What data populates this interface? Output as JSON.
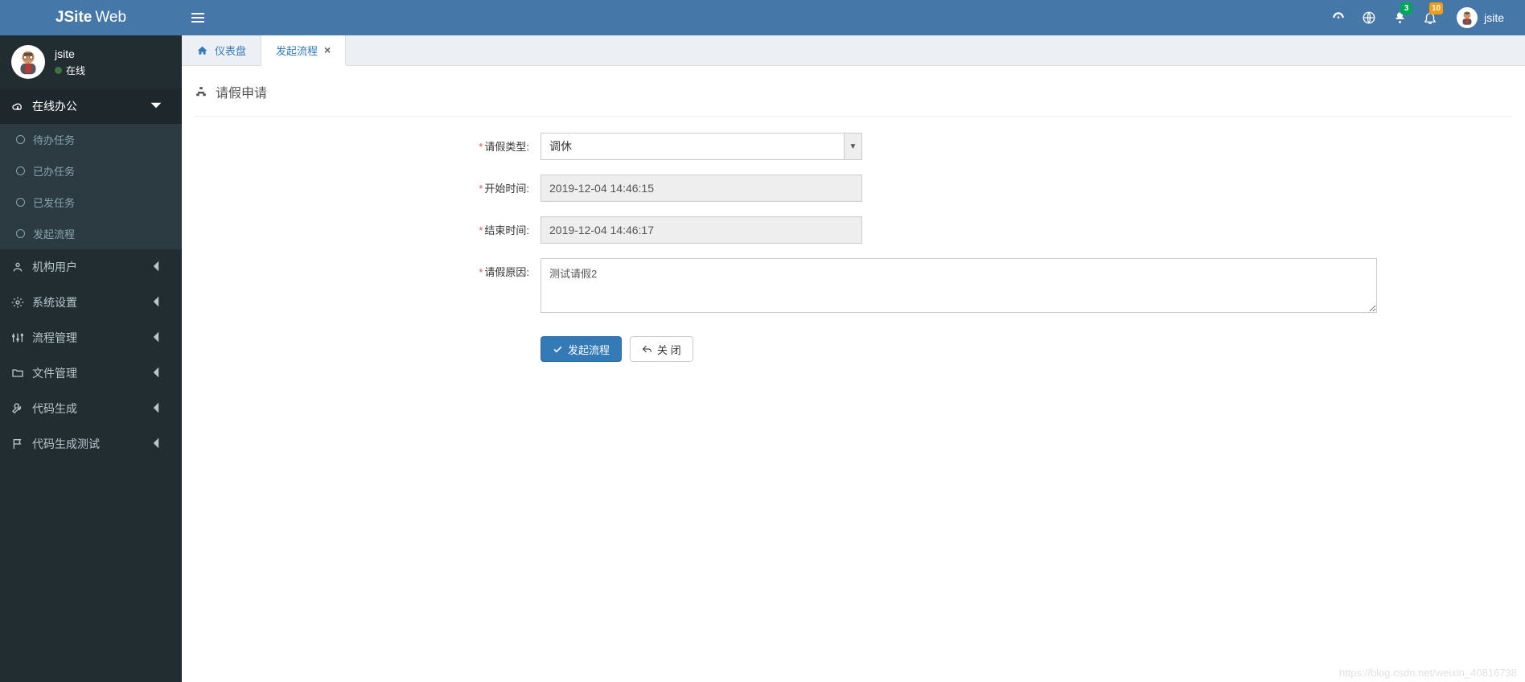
{
  "brand": {
    "bold": "JSite",
    "light": "Web"
  },
  "topbar": {
    "messages_badge": "3",
    "notifications_badge": "10",
    "username": "jsite"
  },
  "sidebar": {
    "profile_name": "jsite",
    "profile_status": "在线",
    "menu": [
      {
        "label": "在线办公"
      },
      {
        "label": "机构用户"
      },
      {
        "label": "系统设置"
      },
      {
        "label": "流程管理"
      },
      {
        "label": "文件管理"
      },
      {
        "label": "代码生成"
      },
      {
        "label": "代码生成测试"
      }
    ],
    "submenu_online": [
      {
        "label": "待办任务"
      },
      {
        "label": "已办任务"
      },
      {
        "label": "已发任务"
      },
      {
        "label": "发起流程"
      }
    ]
  },
  "tabs": [
    {
      "label": "仪表盘"
    },
    {
      "label": "发起流程"
    }
  ],
  "page": {
    "title": "请假申请",
    "labels": {
      "leave_type": "请假类型:",
      "start_time": "开始时间:",
      "end_time": "结束时间:",
      "reason": "请假原因:"
    },
    "fields": {
      "leave_type": "调休",
      "start_time": "2019-12-04 14:46:15",
      "end_time": "2019-12-04 14:46:17",
      "reason": "测试请假2"
    },
    "buttons": {
      "submit": "发起流程",
      "close": "关 闭"
    }
  },
  "watermark": "https://blog.csdn.net/weixin_40816738"
}
